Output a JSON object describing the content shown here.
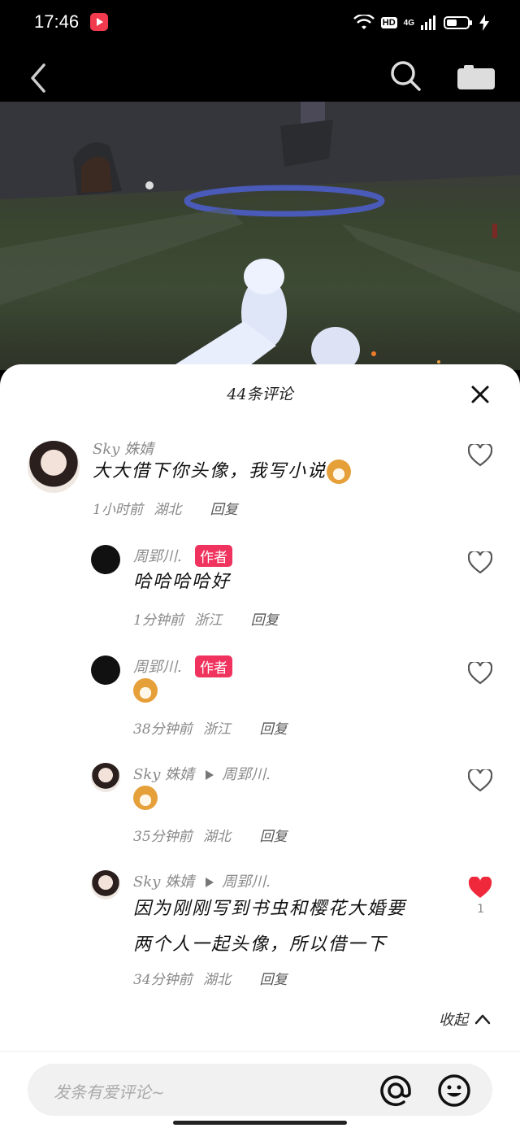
{
  "status_bar": {
    "time": "17:46",
    "hd": "HD",
    "network": "4G"
  },
  "sheet": {
    "title": "44条评论"
  },
  "comments": [
    {
      "user": "Sky 姝婧",
      "text": "大大借下你头像，我写小说",
      "time": "1小时前",
      "location": "湖北",
      "reply": "回复"
    },
    {
      "user": "周郢川.",
      "badge": "作者",
      "text": "哈哈哈哈好",
      "time": "1分钟前",
      "location": "浙江",
      "reply": "回复"
    },
    {
      "user": "周郢川.",
      "badge": "作者",
      "time": "38分钟前",
      "location": "浙江",
      "reply": "回复"
    },
    {
      "user": "Sky 姝婧",
      "reply_to": "周郢川.",
      "time": "35分钟前",
      "location": "湖北",
      "reply": "回复"
    },
    {
      "user": "Sky 姝婧",
      "reply_to": "周郢川.",
      "text_line1": "因为刚刚写到书虫和樱花大婚要",
      "text_line2": "两个人一起头像，所以借一下",
      "time": "34分钟前",
      "location": "湖北",
      "reply": "回复",
      "like_count": "1",
      "liked": true
    }
  ],
  "collapse_label": "收起",
  "input": {
    "placeholder": "发条有爱评论~"
  },
  "colors": {
    "accent": "#f0335e",
    "like_red": "#f0283c"
  }
}
